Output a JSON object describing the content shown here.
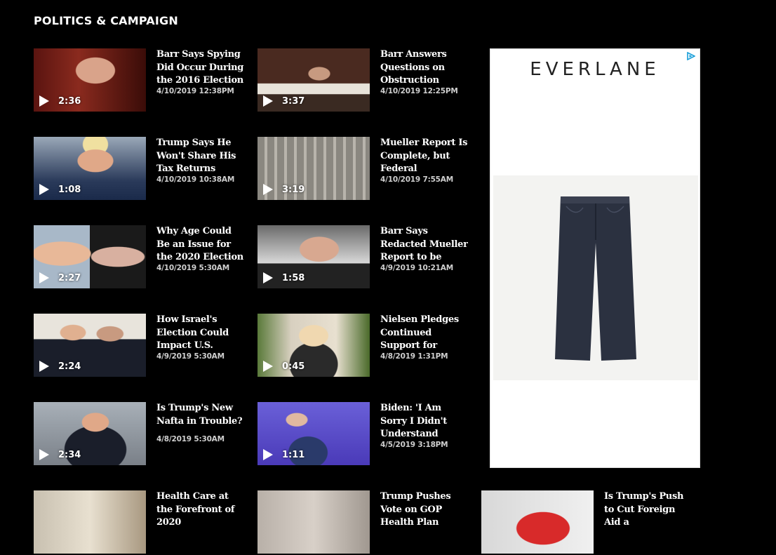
{
  "section": {
    "title": "POLITICS & CAMPAIGN"
  },
  "videos": [
    {
      "headline": "Barr Says Spying Did Occur During the 2016 Election",
      "timestamp": "4/10/2019 12:38PM",
      "duration": "2:36"
    },
    {
      "headline": "Barr Answers Questions on Obstruction",
      "timestamp": "4/10/2019 12:25PM",
      "duration": "3:37"
    },
    {
      "headline": "Trump Says He Won't Share His Tax Returns",
      "timestamp": "4/10/2019 10:38AM",
      "duration": "1:08"
    },
    {
      "headline": "Mueller Report Is Complete, but Federal",
      "timestamp": "4/10/2019 7:55AM",
      "duration": "3:19"
    },
    {
      "headline": "Why Age Could Be an Issue for the 2020 Election",
      "timestamp": "4/10/2019 5:30AM",
      "duration": "2:27"
    },
    {
      "headline": "Barr Says Redacted Mueller Report to be Released",
      "timestamp": "4/9/2019 10:21AM",
      "duration": "1:58"
    },
    {
      "headline": "How Israel's Election Could Impact U.S.",
      "timestamp": "4/9/2019 5:30AM",
      "duration": "2:24"
    },
    {
      "headline": "Nielsen Pledges Continued Support for Trump's Border",
      "timestamp": "4/8/2019 1:31PM",
      "duration": "0:45"
    },
    {
      "headline": "Is Trump's New Nafta in Trouble?",
      "timestamp": "4/8/2019 5:30AM",
      "duration": "2:34"
    },
    {
      "headline": "Biden: 'I Am Sorry I Didn't Understand More'",
      "timestamp": "4/5/2019 3:18PM",
      "duration": "1:11"
    },
    {
      "headline": "Health Care at the Forefront of 2020",
      "timestamp": "",
      "duration": ""
    },
    {
      "headline": "Trump Pushes Vote on GOP Health Plan",
      "timestamp": "",
      "duration": ""
    },
    {
      "headline": "Is Trump's Push to Cut Foreign Aid a",
      "timestamp": "",
      "duration": ""
    }
  ],
  "ad": {
    "brand": "EVERLANE",
    "icon": "adchoices-icon",
    "accent": "#1a9fd9"
  },
  "colors": {
    "background": "#000000",
    "timestamp": "#cfcfcf"
  }
}
